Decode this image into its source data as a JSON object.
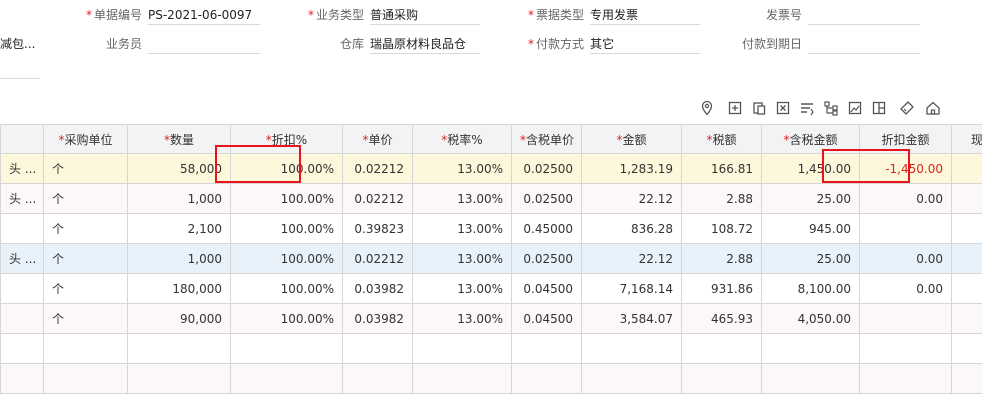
{
  "form": {
    "row1": {
      "doc_no_label": "单据编号",
      "doc_no_value": "PS-2021-06-0097",
      "biz_type_label": "业务类型",
      "biz_type_value": "普通采购",
      "invoice_type_label": "票据类型",
      "invoice_type_value": "专用发票",
      "invoice_no_label": "发票号",
      "invoice_no_value": ""
    },
    "row2": {
      "left_fragment": "减包...",
      "salesperson_label": "业务员",
      "salesperson_value": "",
      "warehouse_label": "仓库",
      "warehouse_value": "瑞晶原材料良品仓",
      "payment_label": "付款方式",
      "payment_value": "其它",
      "due_date_label": "付款到期日",
      "due_date_value": ""
    }
  },
  "toolbar": {
    "icons": [
      "location-icon",
      "add-row-icon",
      "paste-icon",
      "delete-icon",
      "filter-icon",
      "tree-icon",
      "image-icon",
      "layout-icon",
      "tag-icon",
      "home-icon"
    ]
  },
  "table": {
    "headers": [
      {
        "label": "",
        "required": false
      },
      {
        "label": "采购单位",
        "required": true
      },
      {
        "label": "数量",
        "required": true
      },
      {
        "label": "折扣%",
        "required": true
      },
      {
        "label": "单价",
        "required": true
      },
      {
        "label": "税率%",
        "required": true
      },
      {
        "label": "含税单价",
        "required": true
      },
      {
        "label": "金额",
        "required": true
      },
      {
        "label": "税额",
        "required": true
      },
      {
        "label": "含税金额",
        "required": true
      },
      {
        "label": "折扣金额",
        "required": false
      },
      {
        "label": "现存量",
        "required": false
      }
    ],
    "rows": [
      {
        "style": "yellow",
        "cells": [
          "头 ...",
          "个",
          "58,000",
          "100.00%",
          "0.02212",
          "13.00%",
          "0.02500",
          "1,283.19",
          "166.81",
          "1,450.00",
          "-1,450.00",
          ""
        ]
      },
      {
        "style": "pink",
        "cells": [
          "头 ...",
          "个",
          "1,000",
          "100.00%",
          "0.02212",
          "13.00%",
          "0.02500",
          "22.12",
          "2.88",
          "25.00",
          "0.00",
          ""
        ]
      },
      {
        "style": "white",
        "cells": [
          "",
          "个",
          "2,100",
          "100.00%",
          "0.39823",
          "13.00%",
          "0.45000",
          "836.28",
          "108.72",
          "945.00",
          "",
          ""
        ]
      },
      {
        "style": "blue",
        "cells": [
          "头 ...",
          "个",
          "1,000",
          "100.00%",
          "0.02212",
          "13.00%",
          "0.02500",
          "22.12",
          "2.88",
          "25.00",
          "0.00",
          ""
        ]
      },
      {
        "style": "white",
        "cells": [
          "",
          "个",
          "180,000",
          "100.00%",
          "0.03982",
          "13.00%",
          "0.04500",
          "7,168.14",
          "931.86",
          "8,100.00",
          "0.00",
          ""
        ]
      },
      {
        "style": "pink",
        "cells": [
          "",
          "个",
          "90,000",
          "100.00%",
          "0.03982",
          "13.00%",
          "0.04500",
          "3,584.07",
          "465.93",
          "4,050.00",
          "",
          ""
        ]
      },
      {
        "style": "white",
        "cells": [
          "",
          "",
          "",
          "",
          "",
          "",
          "",
          "",
          "",
          "",
          "",
          ""
        ]
      },
      {
        "style": "pink",
        "cells": [
          "",
          "",
          "",
          "",
          "",
          "",
          "",
          "",
          "",
          "",
          "",
          ""
        ]
      }
    ]
  },
  "colors": {
    "required": "#e02020",
    "negative": "#d9261c",
    "highlight_box": "#e8141b"
  }
}
